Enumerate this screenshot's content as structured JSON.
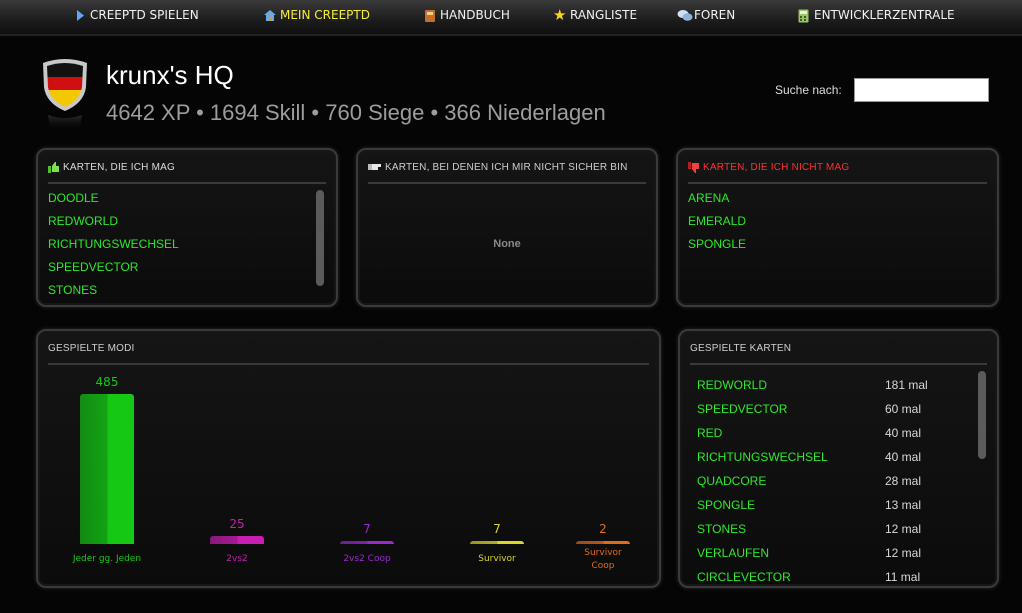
{
  "nav": {
    "items": [
      {
        "label": "CREEPTD SPIELEN",
        "icon": "play-icon",
        "active": false
      },
      {
        "label": "MEIN CREEPTD",
        "icon": "home-icon",
        "active": true
      },
      {
        "label": "HANDBUCH",
        "icon": "book-icon",
        "active": false
      },
      {
        "label": "RANGLISTE",
        "icon": "star-icon",
        "active": false
      },
      {
        "label": "FOREN",
        "icon": "chat-icon",
        "active": false
      },
      {
        "label": "ENTWICKLERZENTRALE",
        "icon": "calculator-icon",
        "active": false
      }
    ]
  },
  "profile": {
    "title": "krunx's HQ",
    "stats": "4642 XP • 1694 Skill • 760 Siege • 366 Niederlagen",
    "flag": "germany"
  },
  "search": {
    "label": "Suche nach:",
    "value": ""
  },
  "liked_maps": {
    "title": "KARTEN, DIE ICH MAG",
    "icon": "thumbs-up-icon",
    "items": [
      "DOODLE",
      "REDWORLD",
      "RICHTUNGSWECHSEL",
      "SPEEDVECTOR",
      "STONES"
    ]
  },
  "unsure_maps": {
    "title": "KARTEN, BEI DENEN ICH MIR NICHT SICHER BIN",
    "icon": "thumbs-sideways-icon",
    "empty_text": "None"
  },
  "disliked_maps": {
    "title": "KARTEN, DIE ICH NICHT MAG",
    "icon": "thumbs-down-icon",
    "items": [
      "ARENA",
      "EMERALD",
      "SPONGLE"
    ]
  },
  "modes": {
    "title": "GESPIELTE MODI"
  },
  "chart_data": {
    "type": "bar",
    "categories": [
      "Jeder gg. Jeden",
      "2vs2",
      "2vs2 Coop",
      "Survivor",
      "Survivor Coop"
    ],
    "values": [
      485,
      25,
      7,
      7,
      2
    ],
    "colors": [
      "#14c814",
      "#c81eb4",
      "#9a28d0",
      "#d8d82a",
      "#e36a1a"
    ],
    "ylim": [
      0,
      485
    ],
    "grid": false
  },
  "played_maps": {
    "title": "GESPIELTE KARTEN",
    "rows": [
      {
        "name": "REDWORLD",
        "count": "181 mal"
      },
      {
        "name": "SPEEDVECTOR",
        "count": "60 mal"
      },
      {
        "name": "RED",
        "count": "40 mal"
      },
      {
        "name": "RICHTUNGSWECHSEL",
        "count": "40 mal"
      },
      {
        "name": "QUADCORE",
        "count": "28 mal"
      },
      {
        "name": "SPONGLE",
        "count": "13 mal"
      },
      {
        "name": "STONES",
        "count": "12 mal"
      },
      {
        "name": "VERLAUFEN",
        "count": "12 mal"
      },
      {
        "name": "CIRCLEVECTOR",
        "count": "11 mal"
      }
    ]
  }
}
